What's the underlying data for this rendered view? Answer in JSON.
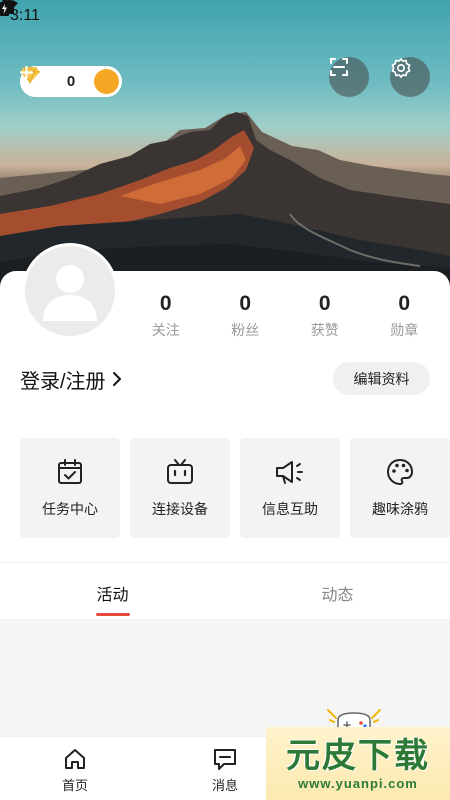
{
  "status_bar": {
    "time": "3:11"
  },
  "header": {
    "coins": {
      "count": "0"
    }
  },
  "profile": {
    "stats": [
      {
        "value": "0",
        "label": "关注"
      },
      {
        "value": "0",
        "label": "粉丝"
      },
      {
        "value": "0",
        "label": "获赞"
      },
      {
        "value": "0",
        "label": "勋章"
      }
    ],
    "login_label": "登录/注册",
    "edit_label": "编辑资料"
  },
  "tiles": [
    {
      "label": "任务中心",
      "icon": "calendar-check-icon"
    },
    {
      "label": "连接设备",
      "icon": "tv-device-icon"
    },
    {
      "label": "信息互助",
      "icon": "megaphone-icon"
    },
    {
      "label": "趣味涂鸦",
      "icon": "palette-icon"
    }
  ],
  "tabs": [
    {
      "label": "活动",
      "active": true
    },
    {
      "label": "动态",
      "active": false
    }
  ],
  "bottom_nav": [
    {
      "label": "首页",
      "icon": "home-icon"
    },
    {
      "label": "消息",
      "icon": "message-icon"
    }
  ],
  "watermark": {
    "title": "元皮下载",
    "url": "www.yuanpi.com"
  },
  "colors": {
    "accent": "#e8493d",
    "coin_plus": "#f5a623",
    "diamond": "#f7c948",
    "watermark_green": "#2d7a37"
  }
}
